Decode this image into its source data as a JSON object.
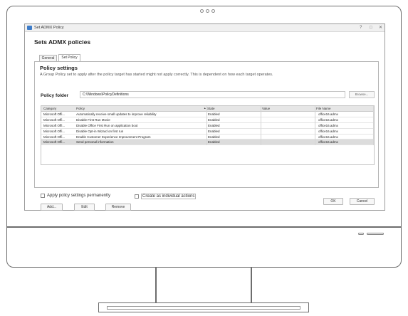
{
  "window": {
    "title": "Set ADMX Policy",
    "heading": "Sets ADMX policies",
    "controls": [
      "?",
      "□",
      "✕"
    ]
  },
  "tabs": [
    {
      "label": "General",
      "active": false
    },
    {
      "label": "Set Policy",
      "active": true
    }
  ],
  "policy_settings": {
    "title": "Policy settings",
    "description": "A Group Policy set to apply after the policy target has started might not apply correctly. This is dependent on how each target operates."
  },
  "policy_folder": {
    "label": "Policy folder",
    "value": "C:\\Windows\\PolicyDefinitions",
    "browse_label": "Browse..."
  },
  "table": {
    "columns": [
      "Category",
      "Policy",
      "State",
      "Value",
      "File Name"
    ],
    "sort_indicator": "▲",
    "rows": [
      {
        "category": "Microsoft Offi...",
        "policy": "Automatically receive small updates to improve reliability",
        "state": "Enabled",
        "value": "",
        "file": "office16.admx",
        "selected": false
      },
      {
        "category": "Microsoft Offi...",
        "policy": "Disable First Run Movie",
        "state": "Enabled",
        "value": "",
        "file": "office16.admx",
        "selected": false
      },
      {
        "category": "Microsoft Offi...",
        "policy": "Disable Office First Run on application boot",
        "state": "Enabled",
        "value": "",
        "file": "office16.admx",
        "selected": false
      },
      {
        "category": "Microsoft Offi...",
        "policy": "Disable Opt-in Wizard on first run",
        "state": "Enabled",
        "value": "",
        "file": "office16.admx",
        "selected": false
      },
      {
        "category": "Microsoft Offi...",
        "policy": "Enable Customer Experience Improvement Program",
        "state": "Enabled",
        "value": "",
        "file": "office16.admx",
        "selected": false
      },
      {
        "category": "Microsoft Offi...",
        "policy": "Send personal information",
        "state": "Enabled",
        "value": "",
        "file": "office16.admx",
        "selected": true
      }
    ]
  },
  "options": {
    "apply_permanently": {
      "label": "Apply policy settings permanently",
      "checked": false
    },
    "individual_actions": {
      "label": "Create as individual actions",
      "checked": false
    }
  },
  "buttons": {
    "add": "Add...",
    "edit": "Edit",
    "remove": "Remove",
    "ok": "OK",
    "cancel": "Cancel"
  }
}
